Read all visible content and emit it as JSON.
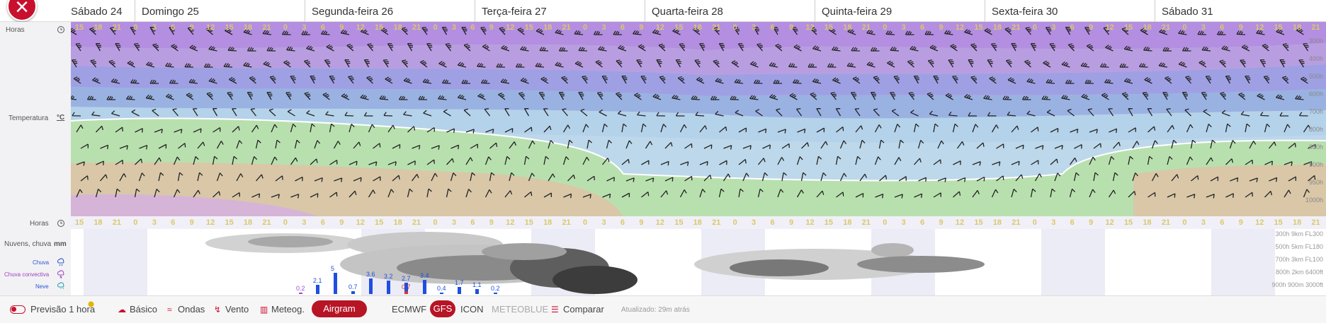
{
  "header": {
    "close_label": "×",
    "days": [
      {
        "label": "Sábado 24"
      },
      {
        "label": "Domingo 25"
      },
      {
        "label": "Segunda-feira 26"
      },
      {
        "label": "Terça-feira 27"
      },
      {
        "label": "Quarta-feira 28"
      },
      {
        "label": "Quinta-feira 29"
      },
      {
        "label": "Sexta-feira 30"
      },
      {
        "label": "Sábado 31"
      }
    ]
  },
  "left_labels": {
    "hours": "Horas",
    "temperature": "Temperatura",
    "temp_unit": "°C",
    "hours2": "Horas",
    "clouds_rain": "Nuvens, chuva",
    "rain_unit": "mm",
    "rain": "Chuva",
    "convective_rain": "Chuva convectiva",
    "snow": "Neve",
    "clock_icon": "clock-icon",
    "rain_icon": "rain-cloud-icon",
    "convective_icon": "convective-cloud-icon",
    "snow_icon": "snow-cloud-icon"
  },
  "hour_ticks": [
    "15",
    "18",
    "21",
    "0",
    "3",
    "6",
    "9",
    "12",
    "15",
    "18",
    "21",
    "0",
    "3",
    "6",
    "9",
    "12",
    "15",
    "18",
    "21",
    "0",
    "3",
    "6",
    "9",
    "12",
    "15",
    "18",
    "21",
    "0",
    "3",
    "6",
    "9",
    "12",
    "15",
    "18",
    "21",
    "0",
    "3",
    "6",
    "9",
    "12",
    "15",
    "18",
    "21",
    "0",
    "3",
    "6",
    "9",
    "12",
    "15",
    "18",
    "21",
    "0",
    "3",
    "6",
    "9",
    "12",
    "15",
    "18",
    "21",
    "0",
    "3",
    "6",
    "9",
    "12",
    "15",
    "18",
    "21"
  ],
  "pressure_levels": [
    {
      "label": "300h"
    },
    {
      "label": "400h"
    },
    {
      "label": "500h"
    },
    {
      "label": "600h"
    },
    {
      "label": "700h"
    },
    {
      "label": "800h"
    },
    {
      "label": "850h"
    },
    {
      "label": "900h"
    },
    {
      "label": "950h"
    },
    {
      "label": "1000h"
    }
  ],
  "cloud_levels": [
    {
      "label": "300h 9km FL300"
    },
    {
      "label": "500h 5km FL180"
    },
    {
      "label": "700h 3km FL100"
    },
    {
      "label": "800h 2km 6400ft"
    },
    {
      "label": "900h 900m 3000ft"
    }
  ],
  "precip_bars": [
    {
      "value": 0.2,
      "label": "0.2",
      "type": "snow"
    },
    {
      "value": 2.1,
      "label": "2.1",
      "type": "rain"
    },
    {
      "value": 5,
      "label": "5",
      "type": "rain"
    },
    {
      "value": 0.7,
      "label": "0.7",
      "type": "rain"
    },
    {
      "value": 3.6,
      "label": "3.6",
      "type": "rain"
    },
    {
      "value": 3.2,
      "label": "3.2",
      "type": "rain"
    },
    {
      "value": 2.7,
      "label": "2.7",
      "type": "rain"
    },
    {
      "value": 0.7,
      "label": "0.7",
      "type": "convective"
    },
    {
      "value": 3.4,
      "label": "3.4",
      "type": "rain"
    },
    {
      "value": 0.4,
      "label": "0.4",
      "type": "rain"
    },
    {
      "value": 1.7,
      "label": "1.7",
      "type": "rain"
    },
    {
      "value": 1.1,
      "label": "1.1",
      "type": "rain"
    },
    {
      "value": 0.2,
      "label": "0.2",
      "type": "rain"
    }
  ],
  "toolbar": {
    "forecast_label": "Previsão 1 hora",
    "basic_label": "Básico",
    "waves_label": "Ondas",
    "wind_label": "Vento",
    "meteog_label": "Meteog.",
    "airgram_label": "Airgram",
    "ecmwf_label": "ECMWF",
    "gfs_label": "GFS",
    "icon_label": "ICON",
    "meteoblue_label": "METEOBLUE",
    "compare_label": "Comparar",
    "updated_label": "Atualizado: 29m atrás"
  },
  "colors": {
    "accent": "#b71426",
    "rain_bar": "#1f4fe0",
    "convective_bar": "#c83a3a",
    "snow_bar": "#9a4fd0",
    "hour_text": "#d9c86a"
  }
}
